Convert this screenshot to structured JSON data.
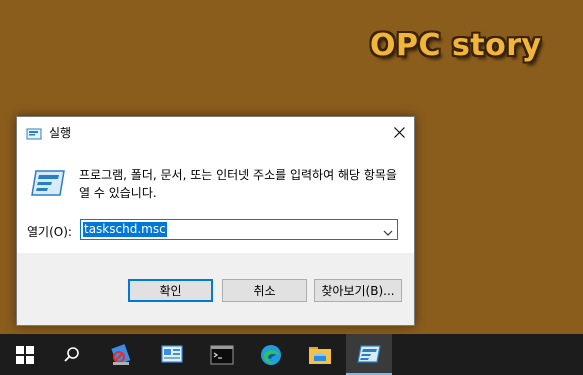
{
  "watermark": "OPC story",
  "dialog": {
    "title": "실행",
    "description": "프로그램, 폴더, 문서, 또는 인터넷 주소를 입력하여 해당 항목을 열 수 있습니다.",
    "open_label": "열기(O):",
    "open_value": "taskschd.msc",
    "buttons": {
      "ok": "확인",
      "cancel": "취소",
      "browse": "찾아보기(B)..."
    }
  },
  "taskbar": {
    "items": [
      "start-icon",
      "search-icon",
      "app-icon",
      "control-panel-icon",
      "cmd-icon",
      "edge-icon",
      "file-explorer-icon",
      "run-icon"
    ]
  },
  "colors": {
    "desktop": "#8b5d1c",
    "accent": "#0078d7",
    "taskbar": "#1c1c1c"
  }
}
